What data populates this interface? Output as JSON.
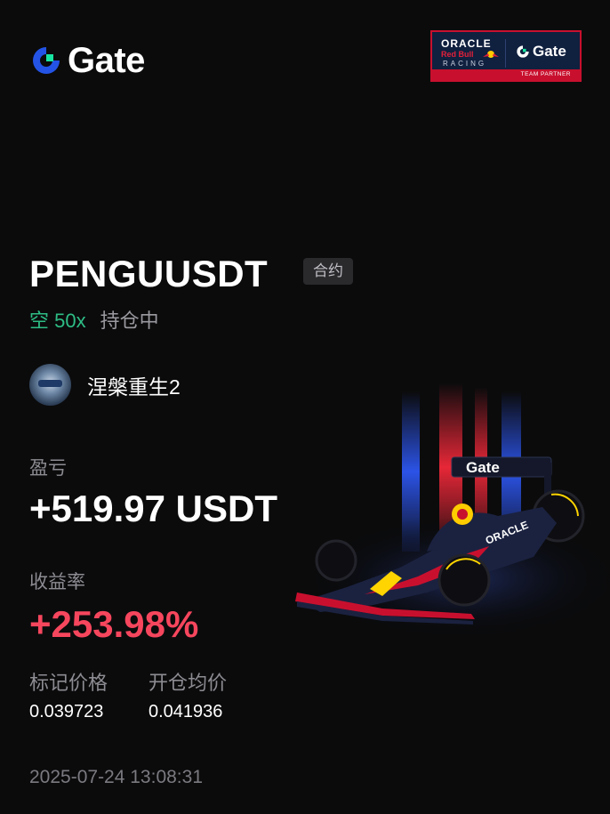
{
  "brand": {
    "name": "Gate"
  },
  "partner_badge": {
    "line1": "ORACLE",
    "line2": "Red Bull",
    "line3": "RACING",
    "brand": "Gate",
    "footer": "TEAM PARTNER"
  },
  "position": {
    "symbol": "PENGUUSDT",
    "market_tag": "合约",
    "side": "空",
    "leverage": "50x",
    "status": "持仓中"
  },
  "user": {
    "name": "涅槃重生2"
  },
  "pnl": {
    "label": "盈亏",
    "value": "+519.97 USDT"
  },
  "roi": {
    "label": "收益率",
    "value": "+253.98%"
  },
  "prices": {
    "mark_label": "标记价格",
    "mark_value": "0.039723",
    "entry_label": "开仓均价",
    "entry_value": "0.041936"
  },
  "timestamp": "2025-07-24 13:08:31",
  "colors": {
    "background": "#0b0b0c",
    "long_short_green": "#2ebd85",
    "roi_red": "#f6465d",
    "muted": "#8c8c92",
    "brand_blue": "#2354e6",
    "brand_green": "#17e6a1"
  }
}
